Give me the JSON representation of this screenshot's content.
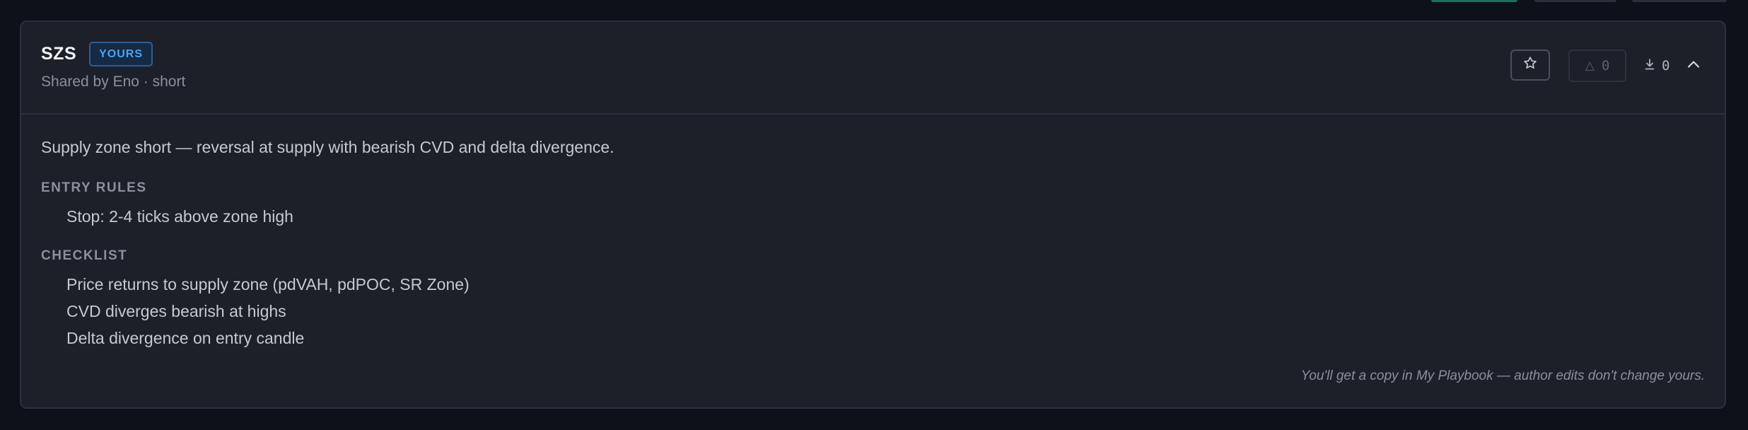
{
  "card": {
    "title": "SZS",
    "badge": "YOURS",
    "subtitle": "Shared by Eno · short",
    "controls": {
      "vote_count": "0",
      "download_count": "0"
    },
    "description": "Supply zone short — reversal at supply with bearish CVD and delta divergence.",
    "entry_rules_label": "ENTRY RULES",
    "entry_rules": [
      "Stop: 2-4 ticks above zone high"
    ],
    "checklist_label": "CHECKLIST",
    "checklist": [
      "Price returns to supply zone (pdVAH, pdPOC, SR Zone)",
      "CVD diverges bearish at highs",
      "Delta divergence on entry candle"
    ],
    "footer_note": "You'll get a copy in My Playbook — author edits don't change yours."
  },
  "icons": {
    "favorite": "star-icon",
    "vote": "triangle-up-icon",
    "download": "download-icon",
    "collapse": "chevron-up-icon"
  },
  "colors": {
    "page_bg": "#0d111a",
    "card_bg": "#1d2029",
    "badge_text": "#4aa3f0",
    "badge_bg": "#152a45"
  }
}
